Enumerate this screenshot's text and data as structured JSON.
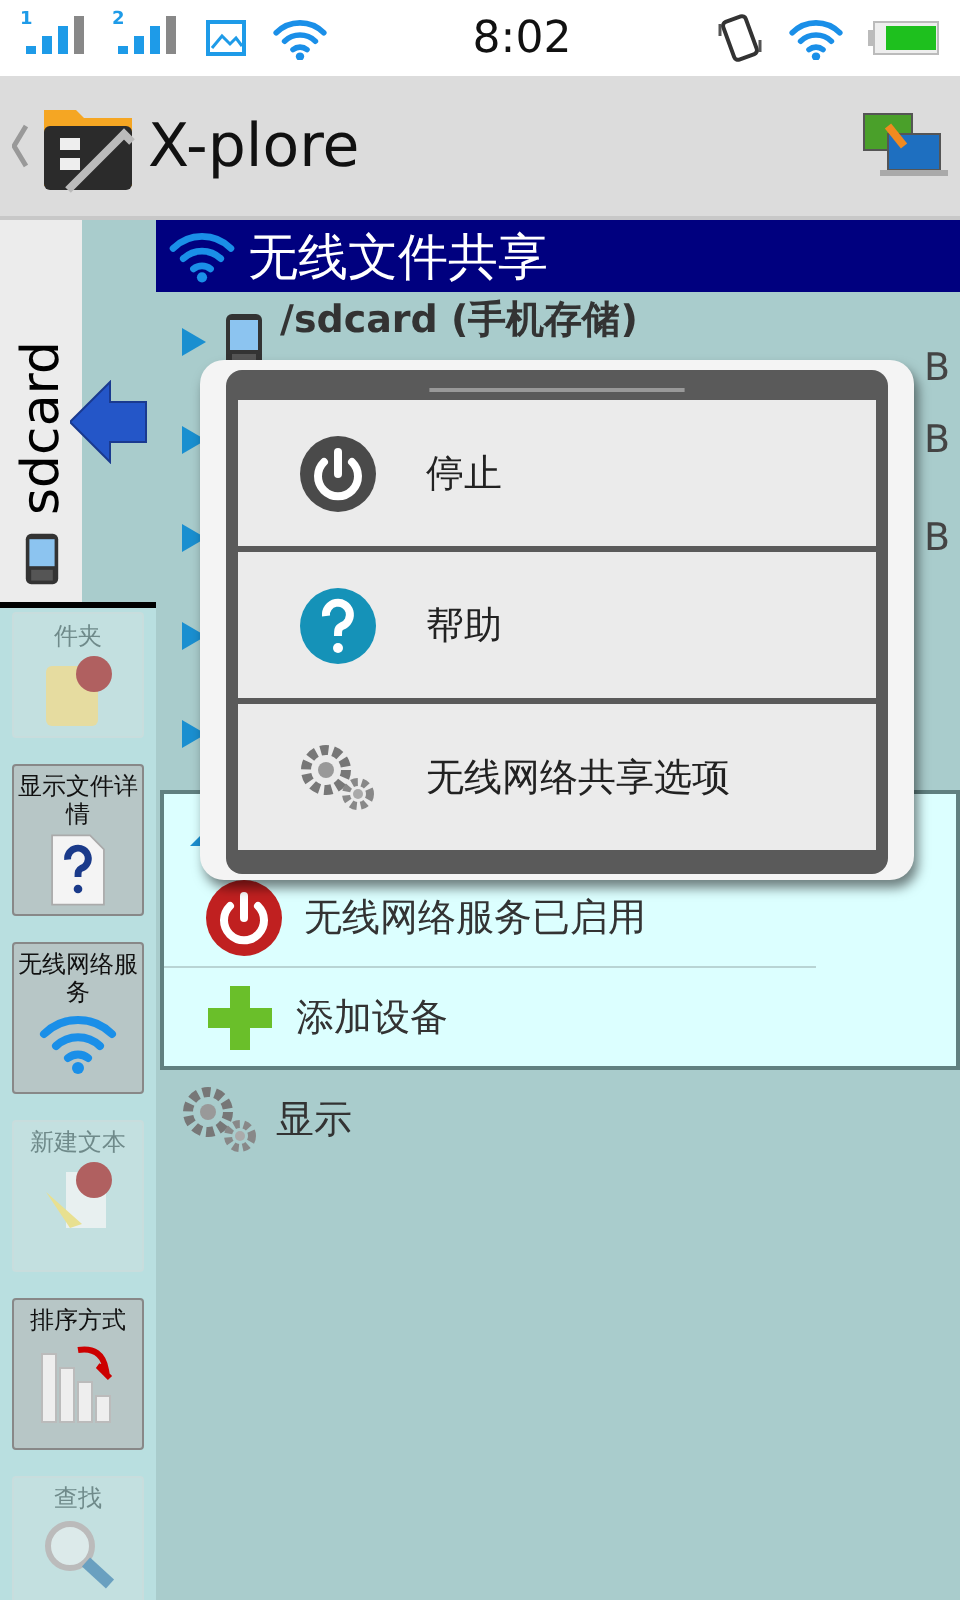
{
  "status_bar": {
    "sim_signals": [
      "1",
      "2"
    ],
    "time": "8:02"
  },
  "app_bar": {
    "title": "X-plore"
  },
  "side_tab": {
    "label": "sdcard"
  },
  "tool_buttons": [
    {
      "kind": "new-folder",
      "label": "件夹",
      "disabled": true
    },
    {
      "kind": "details",
      "label": "显示文件详情",
      "disabled": false
    },
    {
      "kind": "wifi",
      "label": "无线网络服务",
      "disabled": false
    },
    {
      "kind": "new-text",
      "label": "新建文本",
      "disabled": true
    },
    {
      "kind": "sort",
      "label": "排序方式",
      "disabled": false
    },
    {
      "kind": "search",
      "label": "查找",
      "disabled": true
    }
  ],
  "panel": {
    "title": "无线文件共享"
  },
  "tree": [
    {
      "kind": "phone",
      "title": "/sdcard (手机存储)",
      "detail": "B",
      "expanded": false
    },
    {
      "kind": "blank",
      "detail": "B",
      "expanded": false
    },
    {
      "kind": "blank",
      "detail": "B",
      "expanded": false
    },
    {
      "kind": "blank",
      "expanded": false
    },
    {
      "kind": "blank",
      "expanded": false
    },
    {
      "kind": "share",
      "expanded": true,
      "children": [
        {
          "kind": "service",
          "label": "无线网络服务已启用"
        },
        {
          "kind": "add",
          "label": "添加设备"
        }
      ]
    },
    {
      "kind": "settings",
      "title": "显示"
    }
  ],
  "popup_menu": {
    "items": [
      {
        "kind": "stop",
        "label": "停止"
      },
      {
        "kind": "help",
        "label": "帮助"
      },
      {
        "kind": "options",
        "label": "无线网络共享选项"
      }
    ]
  }
}
